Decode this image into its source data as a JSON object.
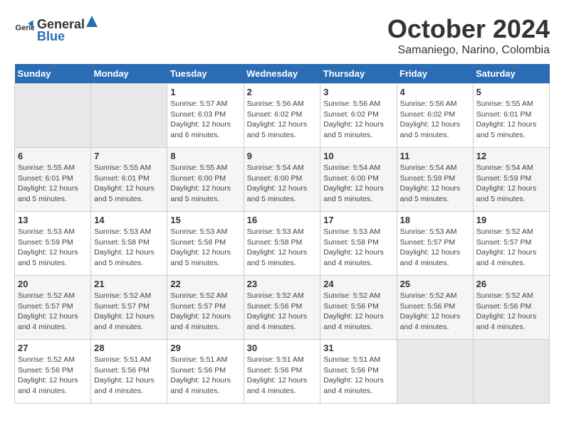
{
  "header": {
    "logo_general": "General",
    "logo_blue": "Blue",
    "month": "October 2024",
    "location": "Samaniego, Narino, Colombia"
  },
  "weekdays": [
    "Sunday",
    "Monday",
    "Tuesday",
    "Wednesday",
    "Thursday",
    "Friday",
    "Saturday"
  ],
  "weeks": [
    [
      {
        "day": "",
        "empty": true
      },
      {
        "day": "",
        "empty": true
      },
      {
        "day": "1",
        "sunrise": "5:57 AM",
        "sunset": "6:03 PM",
        "daylight": "12 hours and 6 minutes."
      },
      {
        "day": "2",
        "sunrise": "5:56 AM",
        "sunset": "6:02 PM",
        "daylight": "12 hours and 5 minutes."
      },
      {
        "day": "3",
        "sunrise": "5:56 AM",
        "sunset": "6:02 PM",
        "daylight": "12 hours and 5 minutes."
      },
      {
        "day": "4",
        "sunrise": "5:56 AM",
        "sunset": "6:02 PM",
        "daylight": "12 hours and 5 minutes."
      },
      {
        "day": "5",
        "sunrise": "5:55 AM",
        "sunset": "6:01 PM",
        "daylight": "12 hours and 5 minutes."
      }
    ],
    [
      {
        "day": "6",
        "sunrise": "5:55 AM",
        "sunset": "6:01 PM",
        "daylight": "12 hours and 5 minutes."
      },
      {
        "day": "7",
        "sunrise": "5:55 AM",
        "sunset": "6:01 PM",
        "daylight": "12 hours and 5 minutes."
      },
      {
        "day": "8",
        "sunrise": "5:55 AM",
        "sunset": "6:00 PM",
        "daylight": "12 hours and 5 minutes."
      },
      {
        "day": "9",
        "sunrise": "5:54 AM",
        "sunset": "6:00 PM",
        "daylight": "12 hours and 5 minutes."
      },
      {
        "day": "10",
        "sunrise": "5:54 AM",
        "sunset": "6:00 PM",
        "daylight": "12 hours and 5 minutes."
      },
      {
        "day": "11",
        "sunrise": "5:54 AM",
        "sunset": "5:59 PM",
        "daylight": "12 hours and 5 minutes."
      },
      {
        "day": "12",
        "sunrise": "5:54 AM",
        "sunset": "5:59 PM",
        "daylight": "12 hours and 5 minutes."
      }
    ],
    [
      {
        "day": "13",
        "sunrise": "5:53 AM",
        "sunset": "5:59 PM",
        "daylight": "12 hours and 5 minutes."
      },
      {
        "day": "14",
        "sunrise": "5:53 AM",
        "sunset": "5:58 PM",
        "daylight": "12 hours and 5 minutes."
      },
      {
        "day": "15",
        "sunrise": "5:53 AM",
        "sunset": "5:58 PM",
        "daylight": "12 hours and 5 minutes."
      },
      {
        "day": "16",
        "sunrise": "5:53 AM",
        "sunset": "5:58 PM",
        "daylight": "12 hours and 5 minutes."
      },
      {
        "day": "17",
        "sunrise": "5:53 AM",
        "sunset": "5:58 PM",
        "daylight": "12 hours and 4 minutes."
      },
      {
        "day": "18",
        "sunrise": "5:53 AM",
        "sunset": "5:57 PM",
        "daylight": "12 hours and 4 minutes."
      },
      {
        "day": "19",
        "sunrise": "5:52 AM",
        "sunset": "5:57 PM",
        "daylight": "12 hours and 4 minutes."
      }
    ],
    [
      {
        "day": "20",
        "sunrise": "5:52 AM",
        "sunset": "5:57 PM",
        "daylight": "12 hours and 4 minutes."
      },
      {
        "day": "21",
        "sunrise": "5:52 AM",
        "sunset": "5:57 PM",
        "daylight": "12 hours and 4 minutes."
      },
      {
        "day": "22",
        "sunrise": "5:52 AM",
        "sunset": "5:57 PM",
        "daylight": "12 hours and 4 minutes."
      },
      {
        "day": "23",
        "sunrise": "5:52 AM",
        "sunset": "5:56 PM",
        "daylight": "12 hours and 4 minutes."
      },
      {
        "day": "24",
        "sunrise": "5:52 AM",
        "sunset": "5:56 PM",
        "daylight": "12 hours and 4 minutes."
      },
      {
        "day": "25",
        "sunrise": "5:52 AM",
        "sunset": "5:56 PM",
        "daylight": "12 hours and 4 minutes."
      },
      {
        "day": "26",
        "sunrise": "5:52 AM",
        "sunset": "5:56 PM",
        "daylight": "12 hours and 4 minutes."
      }
    ],
    [
      {
        "day": "27",
        "sunrise": "5:52 AM",
        "sunset": "5:56 PM",
        "daylight": "12 hours and 4 minutes."
      },
      {
        "day": "28",
        "sunrise": "5:51 AM",
        "sunset": "5:56 PM",
        "daylight": "12 hours and 4 minutes."
      },
      {
        "day": "29",
        "sunrise": "5:51 AM",
        "sunset": "5:56 PM",
        "daylight": "12 hours and 4 minutes."
      },
      {
        "day": "30",
        "sunrise": "5:51 AM",
        "sunset": "5:56 PM",
        "daylight": "12 hours and 4 minutes."
      },
      {
        "day": "31",
        "sunrise": "5:51 AM",
        "sunset": "5:56 PM",
        "daylight": "12 hours and 4 minutes."
      },
      {
        "day": "",
        "empty": true
      },
      {
        "day": "",
        "empty": true
      }
    ]
  ]
}
